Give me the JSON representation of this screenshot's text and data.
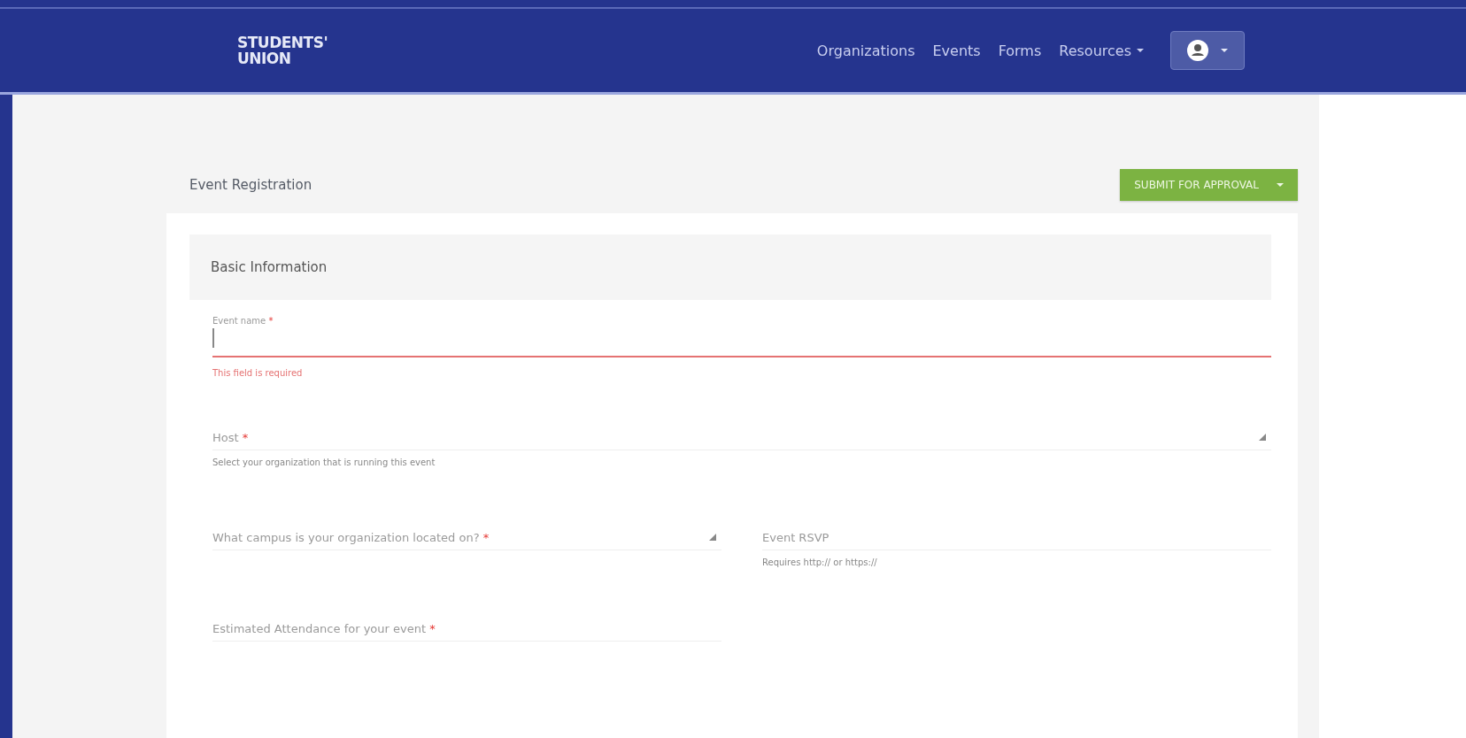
{
  "navbar": {
    "logo": {
      "line_1": "STUDENTS'",
      "line_2": "UNION"
    },
    "links": [
      {
        "label": "Organizations",
        "dropdown": false
      },
      {
        "label": "Events",
        "dropdown": false
      },
      {
        "label": "Forms",
        "dropdown": false
      },
      {
        "label": "Resources",
        "dropdown": true
      }
    ]
  },
  "page": {
    "title": "Event Registration",
    "submit_button": "SUBMIT FOR APPROVAL"
  },
  "section": {
    "title": "Basic Information",
    "rows": [
      {
        "fields": [
          {
            "label": "Event name",
            "required_mark": "*",
            "kind": "text",
            "focused": true,
            "invalid": true,
            "error": "This field is required"
          }
        ]
      },
      {
        "fields": [
          {
            "label": "Host",
            "required_mark": "*",
            "kind": "select",
            "focused": false,
            "invalid": false,
            "help": "Select your organization that is running this event"
          }
        ]
      },
      {
        "fields": [
          {
            "label": "What campus is your organization located on?",
            "required_mark": "*",
            "kind": "select",
            "focused": false,
            "invalid": false
          },
          {
            "label": "Event RSVP",
            "kind": "text",
            "focused": false,
            "invalid": false,
            "help": "Requires http:// or https://"
          }
        ]
      },
      {
        "fields": [
          {
            "label": "Estimated Attendance for your event",
            "required_mark": "*",
            "kind": "text",
            "focused": false,
            "invalid": false
          },
          {
            "kind": "empty"
          }
        ]
      }
    ]
  }
}
